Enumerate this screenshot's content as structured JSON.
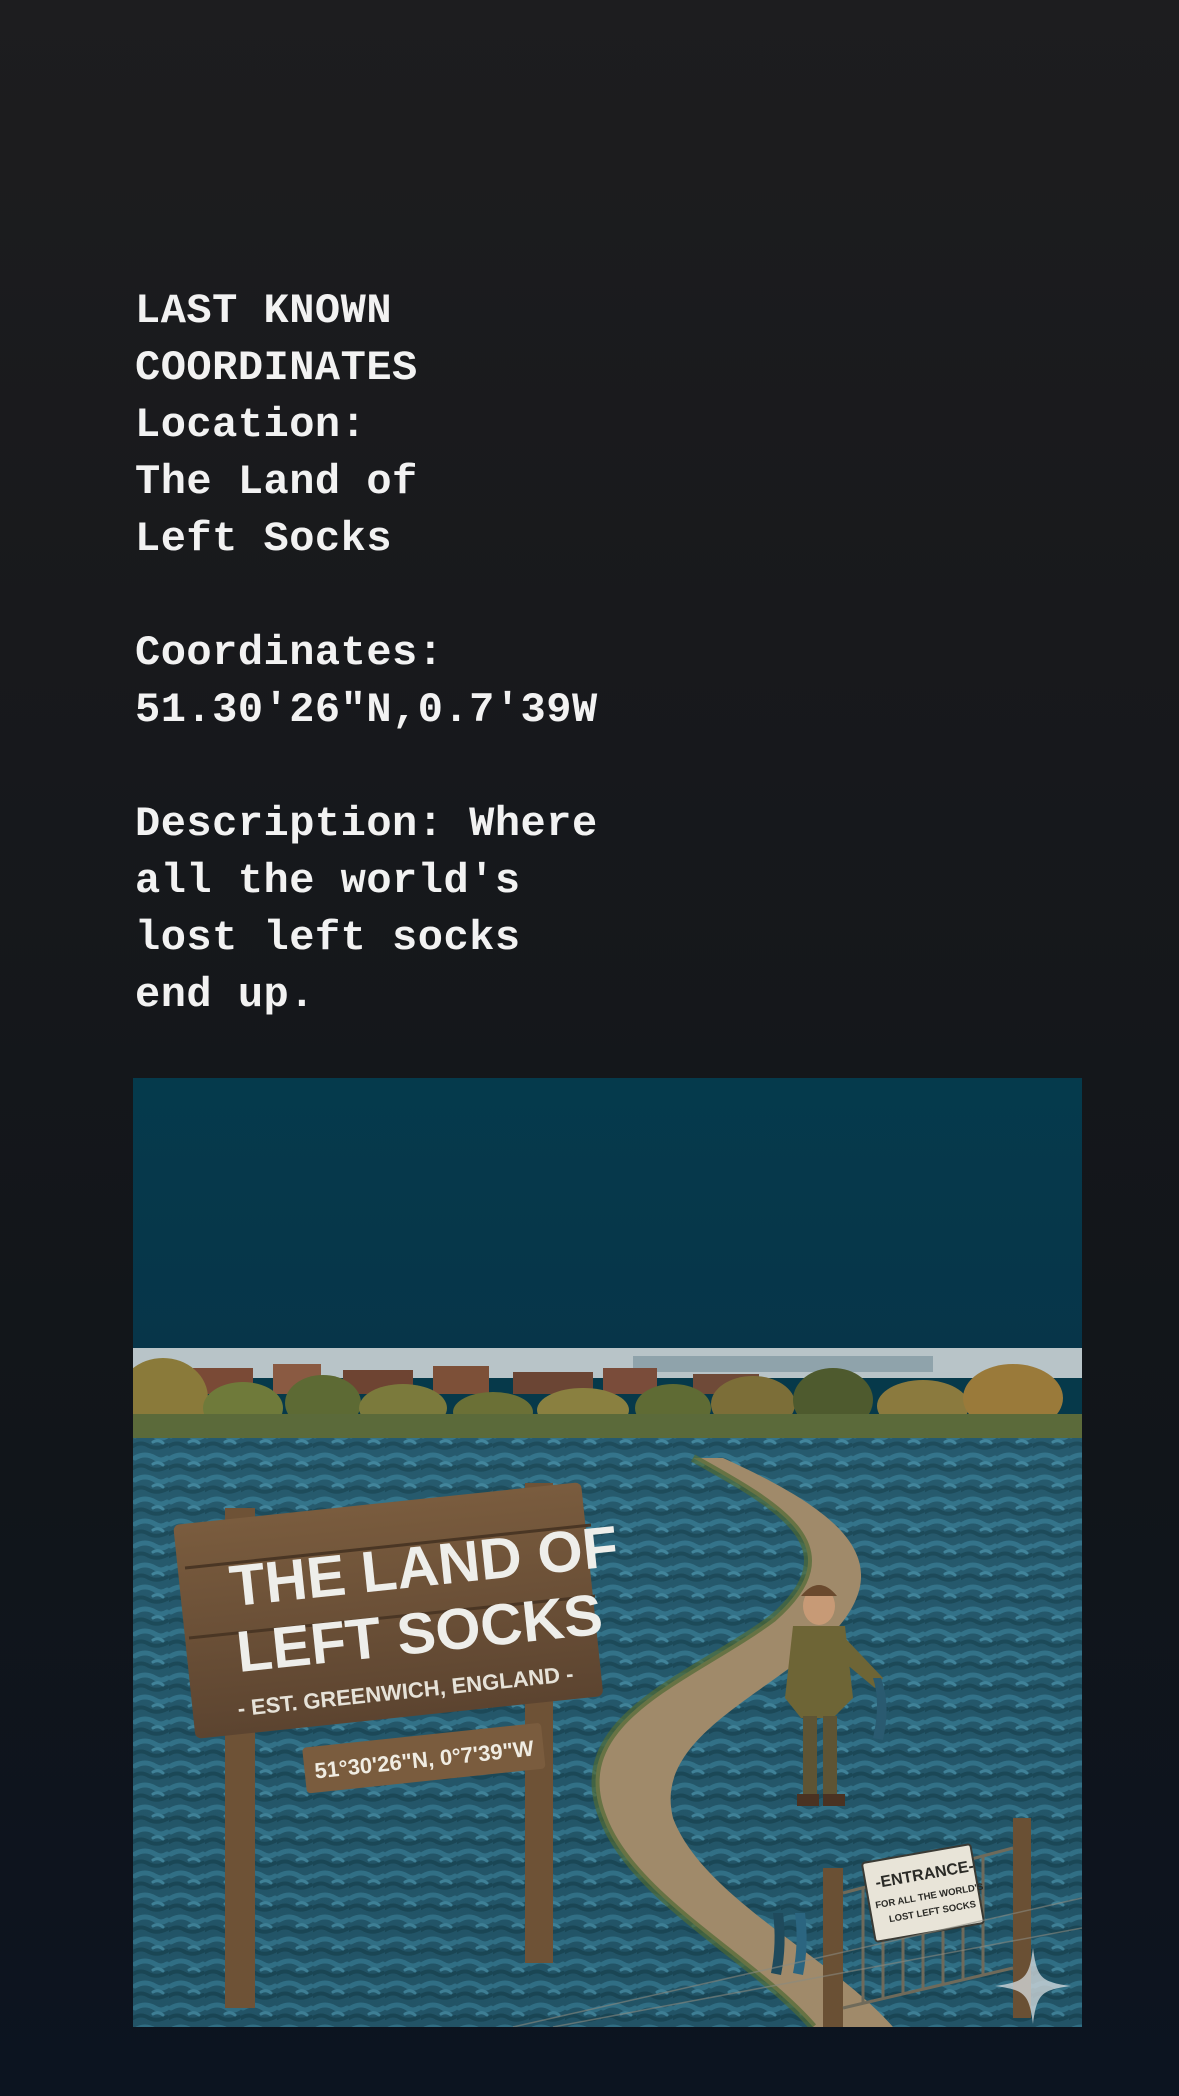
{
  "post": {
    "heading": [
      "LAST KNOWN",
      "COORDINATES"
    ],
    "location_label": "Location:",
    "location_value": [
      "The Land of",
      "Left Socks"
    ],
    "coordinates_label": "Coordinates:",
    "coordinates_value": "51.30'26\"N,0.7'39W",
    "description_lines": [
      "Description: Where",
      "all the world's",
      "lost left socks",
      "end up."
    ]
  },
  "image": {
    "sign_title_1": "THE LAND OF",
    "sign_title_2": "LEFT SOCKS",
    "sign_subtitle": "- EST. GREENWICH, ENGLAND -",
    "sign_coords": "51°30'26\"N, 0°7'39\"W",
    "gate_sign_1": "-ENTRANCE-",
    "gate_sign_2": "FOR ALL THE WORLD'S",
    "gate_sign_3": "LOST LEFT SOCKS",
    "colors": {
      "sky": "#05384a",
      "socks": "#2f6f86",
      "wood": "#6b5036"
    }
  }
}
